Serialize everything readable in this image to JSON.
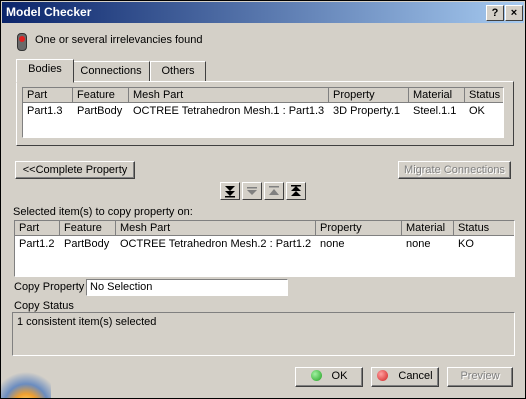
{
  "window": {
    "title": "Model Checker",
    "help_button": "?",
    "close_button": "×"
  },
  "status_message": "One or several irrelevancies found",
  "tabs": [
    {
      "label": "Bodies",
      "active": true
    },
    {
      "label": "Connections",
      "active": false
    },
    {
      "label": "Others",
      "active": false
    }
  ],
  "bodies_table": {
    "columns": [
      "Part",
      "Feature",
      "Mesh Part",
      "Property",
      "Material",
      "Status"
    ],
    "rows": [
      [
        "Part1.3",
        "PartBody",
        "OCTREE Tetrahedron Mesh.1 : Part1.3",
        "3D Property.1",
        "Steel.1.1",
        "OK"
      ]
    ]
  },
  "buttons": {
    "complete_property": "<<Complete Property",
    "migrate_connections": "Migrate Connections",
    "ok": "OK",
    "cancel": "Cancel",
    "preview": "Preview"
  },
  "arrow_buttons": [
    "move-bottom-icon",
    "move-down-icon",
    "move-up-icon",
    "move-top-icon"
  ],
  "selected_section": {
    "label": "Selected item(s) to copy property on:",
    "columns": [
      "Part",
      "Feature",
      "Mesh Part",
      "Property",
      "Material",
      "Status"
    ],
    "rows": [
      [
        "Part1.2",
        "PartBody",
        "OCTREE Tetrahedron Mesh.2 : Part1.2",
        "none",
        "none",
        "KO"
      ]
    ]
  },
  "copy_property": {
    "label": "Copy Property",
    "value": "No Selection"
  },
  "copy_status": {
    "label": "Copy Status",
    "text": "1 consistent item(s) selected"
  },
  "colors": {
    "ok_dot": "#20a020",
    "cancel_dot": "#d02020"
  }
}
